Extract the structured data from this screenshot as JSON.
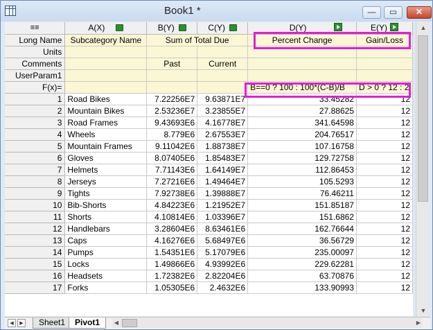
{
  "window": {
    "title": "Book1 *",
    "minimize": "—",
    "maximize": "▭",
    "close": "✕"
  },
  "corner_icon": "grid-menu-icon",
  "columns": [
    {
      "name": "A(X)"
    },
    {
      "name": "B(Y)"
    },
    {
      "name": "C(Y)"
    },
    {
      "name": "D(Y)"
    },
    {
      "name": "E(Y)"
    }
  ],
  "row_labels": {
    "long_name": "Long Name",
    "units": "Units",
    "comments": "Comments",
    "userparam1": "UserParam1",
    "fx": "F(x)="
  },
  "long_name": {
    "a": "Subcategory Name",
    "bc": "Sum of Total Due",
    "d": "Percent Change",
    "e": "Gain/Loss"
  },
  "comments": {
    "a": "",
    "b": "Past",
    "c": "Current"
  },
  "fx": {
    "d": "B==0 ? 100 : 100*(C-B)/B",
    "e": "D > 0 ? 12 : 2"
  },
  "rows": [
    {
      "n": "1",
      "a": "Road Bikes",
      "b": "7.22256E7",
      "c": "9.63871E7",
      "d": "33.45282",
      "e": "12"
    },
    {
      "n": "2",
      "a": "Mountain Bikes",
      "b": "2.53236E7",
      "c": "3.23855E7",
      "d": "27.88625",
      "e": "12"
    },
    {
      "n": "3",
      "a": "Road Frames",
      "b": "9.43693E6",
      "c": "4.16778E7",
      "d": "341.64598",
      "e": "12"
    },
    {
      "n": "4",
      "a": "Wheels",
      "b": "8.779E6",
      "c": "2.67553E7",
      "d": "204.76517",
      "e": "12"
    },
    {
      "n": "5",
      "a": "Mountain Frames",
      "b": "9.11042E6",
      "c": "1.88738E7",
      "d": "107.16758",
      "e": "12"
    },
    {
      "n": "6",
      "a": "Gloves",
      "b": "8.07405E6",
      "c": "1.85483E7",
      "d": "129.72758",
      "e": "12"
    },
    {
      "n": "7",
      "a": "Helmets",
      "b": "7.71143E6",
      "c": "1.64149E7",
      "d": "112.86453",
      "e": "12"
    },
    {
      "n": "8",
      "a": "Jerseys",
      "b": "7.27216E6",
      "c": "1.49464E7",
      "d": "105.5293",
      "e": "12"
    },
    {
      "n": "9",
      "a": "Tights",
      "b": "7.92738E6",
      "c": "1.39888E7",
      "d": "76.46211",
      "e": "12"
    },
    {
      "n": "10",
      "a": "Bib-Shorts",
      "b": "4.84223E6",
      "c": "1.21952E7",
      "d": "151.85187",
      "e": "12"
    },
    {
      "n": "11",
      "a": "Shorts",
      "b": "4.10814E6",
      "c": "1.03396E7",
      "d": "151.6862",
      "e": "12"
    },
    {
      "n": "12",
      "a": "Handlebars",
      "b": "3.28604E6",
      "c": "8.63461E6",
      "d": "162.76644",
      "e": "12"
    },
    {
      "n": "13",
      "a": "Caps",
      "b": "4.16276E6",
      "c": "5.68497E6",
      "d": "36.56729",
      "e": "12"
    },
    {
      "n": "14",
      "a": "Pumps",
      "b": "1.54351E6",
      "c": "5.17079E6",
      "d": "235.00097",
      "e": "12"
    },
    {
      "n": "15",
      "a": "Locks",
      "b": "1.49866E6",
      "c": "4.93992E6",
      "d": "229.62281",
      "e": "12"
    },
    {
      "n": "16",
      "a": "Headsets",
      "b": "1.72382E6",
      "c": "2.82204E6",
      "d": "63.70876",
      "e": "12"
    },
    {
      "n": "17",
      "a": "Forks",
      "b": "1.05305E6",
      "c": "2.4632E6",
      "d": "133.90993",
      "e": "12"
    }
  ],
  "sheets": [
    {
      "label": "Sheet1",
      "active": false
    },
    {
      "label": "Pivot1",
      "active": true
    }
  ],
  "highlight_color": "#e21ddb"
}
